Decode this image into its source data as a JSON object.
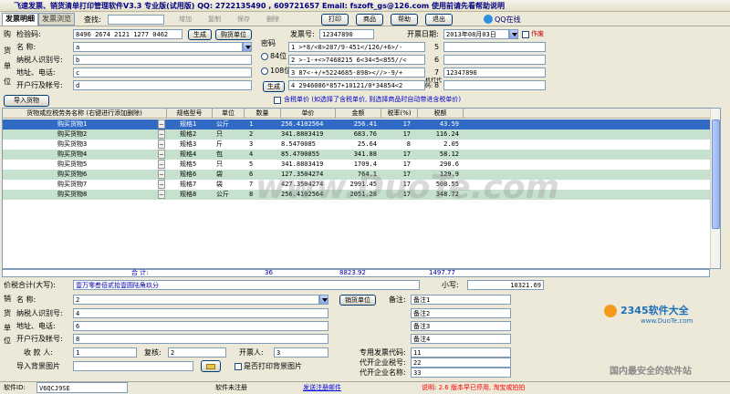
{
  "window": {
    "title": "飞速发票、销货清单打印管理软件V3.3  专业版(试用版)    QQ: 2722135490 , 609721657   Email: fszoft_gs@126.com  使用前请先看帮助说明"
  },
  "toolbar": {
    "tabs": [
      "发票明细",
      "发票浏览"
    ],
    "search_label": "查找:",
    "disabled_buttons": [
      "增加",
      "复制",
      "保存",
      "删除"
    ],
    "buttons": [
      "打印",
      "商品",
      "帮助",
      "退出"
    ],
    "qq_label": "QQ在线"
  },
  "buyer": {
    "side_label": [
      "购",
      "货",
      "单",
      "位"
    ],
    "check_code_label": "检验码:",
    "check_code": "8496 2674 2121 1277 0462",
    "generate_label": "生成",
    "buyer_unit_label": "购货单位",
    "name_label": "名    称:",
    "name": "a",
    "taxid_label": "纳税人识别号:",
    "taxid": "b",
    "address_label": "地址、电话:",
    "address": "c",
    "bank_label": "开户行及帐号:",
    "bank": "d"
  },
  "cipher": {
    "label": "密码",
    "opt84": "84位",
    "opt108": "108位",
    "generate_label": "生成",
    "lines": [
      "1 >*8/<8>287/9-451</126/+6>/-",
      "2 >-1-+<>7468215 6<34<5<855//<",
      "3 87<-+/+5224685-898><//>-9/+",
      "4 2946086*857+10121/0*34854<2"
    ],
    "right_numbers": [
      "5",
      "6",
      "7",
      "8"
    ],
    "right_values": [
      "",
      "",
      "12347890",
      ""
    ],
    "machine_code_label": "机打代码:"
  },
  "invoice": {
    "number_label": "发票号:",
    "number": "12347890",
    "date_label": "开票日期:",
    "date": "2013年08月03日",
    "void_label": "作废"
  },
  "import_goods_label": "导入货物",
  "tax_included_label": "含税单价  (如选择了含税单价, 则选择商品时自动带进含税单价)",
  "table": {
    "headers": [
      "货物或应税劳务名称 (右键进行添加删除)",
      "规格型号",
      "单位",
      "数量",
      "单价",
      "金额",
      "税率(%)",
      "税额"
    ],
    "rows": [
      [
        "购买货物1",
        "规格1",
        "公斤",
        "1",
        "256.4102564",
        "256.41",
        "17",
        "43.59"
      ],
      [
        "购买货物2",
        "规格2",
        "只",
        "2",
        "341.8803419",
        "683.76",
        "17",
        "116.24"
      ],
      [
        "购买货物3",
        "规格3",
        "斤",
        "3",
        "8.5470085",
        "25.64",
        "8",
        "2.05"
      ],
      [
        "购买货物4",
        "规格4",
        "包",
        "4",
        "85.4700855",
        "341.88",
        "17",
        "58.12"
      ],
      [
        "购买货物5",
        "规格5",
        "只",
        "5",
        "341.8803419",
        "1709.4",
        "17",
        "290.6"
      ],
      [
        "购买货物6",
        "规格6",
        "袋",
        "6",
        "127.3504274",
        "764.1",
        "17",
        "129.9"
      ],
      [
        "购买货物7",
        "规格7",
        "袋",
        "7",
        "427.3504274",
        "2991.45",
        "17",
        "508.55"
      ],
      [
        "购买货物8",
        "规格8",
        "公斤",
        "8",
        "256.4102564",
        "2051.28",
        "17",
        "348.72"
      ]
    ],
    "sum_label": "合    计:",
    "sum_qty": "36",
    "sum_amount": "8823.92",
    "sum_tax": "1497.77"
  },
  "total": {
    "label": "价税合计(大写):",
    "upper": "壹万零叁佰贰拾壹圆陆角玖分",
    "lower_label": "小写:",
    "lower": "10321.69"
  },
  "seller": {
    "side_label": [
      "销",
      "货",
      "单",
      "位"
    ],
    "name_label": "名    称:",
    "name": "2",
    "seller_unit_label": "销货单位",
    "taxid_label": "纳税人识别号:",
    "taxid": "4",
    "address_label": "地址、电话:",
    "address": "6",
    "bank_label": "开户行及帐号:",
    "bank": "8",
    "payee_label": "收 款 人:",
    "payee": "1",
    "reviewer_label": "复核:",
    "reviewer": "2",
    "drawer_label": "开票人:",
    "drawer": "3",
    "bg_label": "导入背景图片",
    "print_bg_label": "是否打印背景图片"
  },
  "remarks": {
    "label": "备注:",
    "items": [
      "备注1",
      "备注2",
      "备注3",
      "备注4"
    ]
  },
  "agent": {
    "code_label": "专用发票代码:",
    "code": "11",
    "taxno_label": "代开企业税号:",
    "taxno": "22",
    "name_label": "代开企业名称:",
    "name": "33"
  },
  "status": {
    "software_id_label": "软件ID:",
    "software_id": "V6QCJ9SE",
    "unregistered": "软件未注册",
    "register_link": "发送注册邮件",
    "notice": "说明: 2.6 版本早已停用, 淘宝或拍拍"
  },
  "watermark": "www.DuoTe.com",
  "corner_logo": {
    "brand": "2345软件大全",
    "url": "www.DuoTe.com",
    "slogan": "国内最安全的软件站"
  },
  "colors": {
    "row_alt": "#c7e1cf",
    "row_selected": "#316ac5",
    "link": "#0000ee",
    "notice": "#ff0000"
  }
}
